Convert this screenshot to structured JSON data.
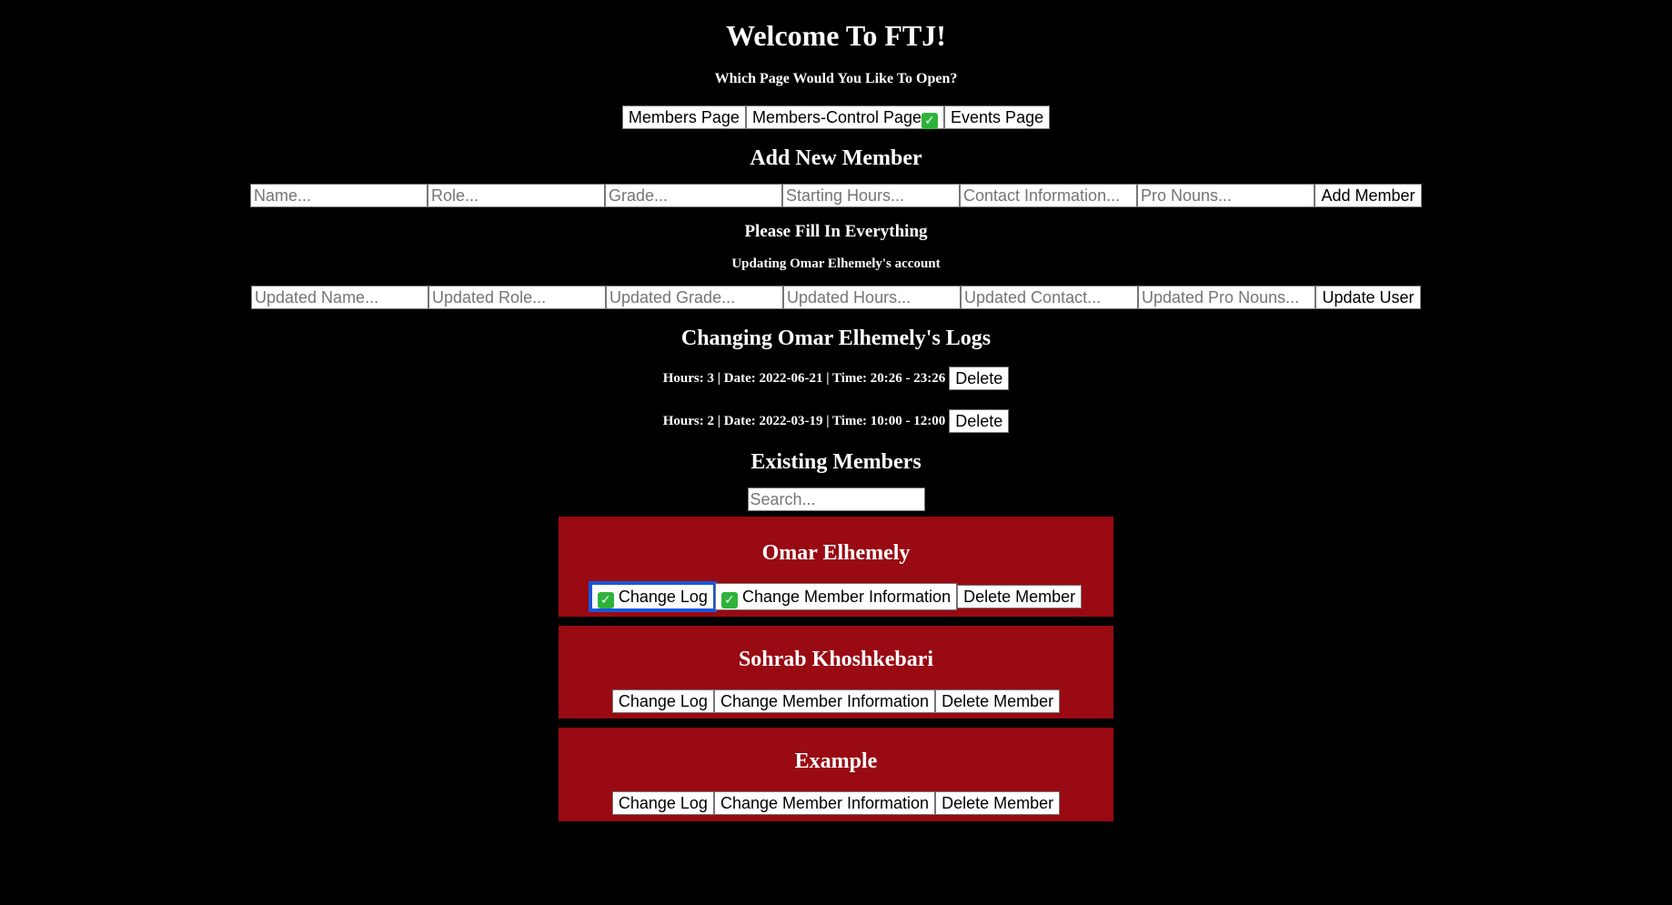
{
  "header": {
    "title": "Welcome To FTJ!",
    "subtitle": "Which Page Would You Like To Open?"
  },
  "nav": {
    "members_page": "Members Page",
    "members_control_page": "Members-Control Page",
    "events_page": "Events Page"
  },
  "add_member": {
    "heading": "Add New Member",
    "placeholders": {
      "name": "Name...",
      "role": "Role...",
      "grade": "Grade...",
      "hours": "Starting Hours...",
      "contact": "Contact Information...",
      "pronouns": "Pro Nouns..."
    },
    "button": "Add Member",
    "notice": "Please Fill In Everything"
  },
  "update_member": {
    "notice": "Updating Omar Elhemely's account",
    "placeholders": {
      "name": "Updated Name...",
      "role": "Updated Role...",
      "grade": "Updated Grade...",
      "hours": "Updated Hours...",
      "contact": "Updated Contact...",
      "pronouns": "Updated Pro Nouns..."
    },
    "button": "Update User"
  },
  "logs": {
    "heading": "Changing Omar Elhemely's Logs",
    "entries": [
      {
        "text": "Hours: 3 | Date: 2022-06-21 | Time: 20:26 - 23:26",
        "delete_label": "Delete"
      },
      {
        "text": "Hours: 2 | Date: 2022-03-19 | Time: 10:00 - 12:00",
        "delete_label": "Delete"
      }
    ]
  },
  "existing": {
    "heading": "Existing Members",
    "search_placeholder": "Search...",
    "members": [
      {
        "name": "Omar Elhemely",
        "change_log": "Change Log",
        "change_info": "Change Member Information",
        "delete": "Delete Member"
      },
      {
        "name": "Sohrab Khoshkebari",
        "change_log": "Change Log",
        "change_info": "Change Member Information",
        "delete": "Delete Member"
      },
      {
        "name": "Example",
        "change_log": "Change Log",
        "change_info": "Change Member Information",
        "delete": "Delete Member"
      }
    ]
  },
  "colors": {
    "background": "#000000",
    "card": "#990a13",
    "check": "#2eb33a",
    "focus": "#1a56db"
  }
}
